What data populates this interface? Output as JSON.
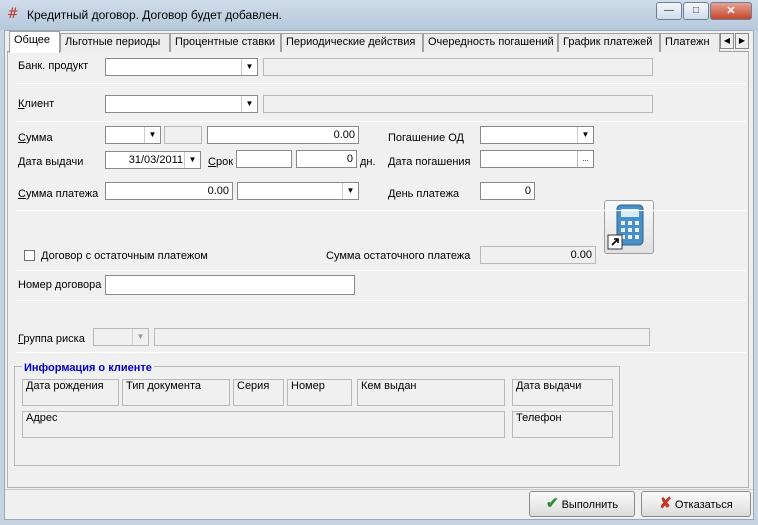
{
  "window": {
    "title": "Кредитный договор. Договор будет добавлен.",
    "title_icon": "hash-icon",
    "controls": {
      "minimize": "—",
      "maximize": "□",
      "close": "✕"
    }
  },
  "tabs": [
    {
      "label": "Общее",
      "active": true
    },
    {
      "label": "Льготные периоды"
    },
    {
      "label": "Процентные ставки"
    },
    {
      "label": "Периодические действия"
    },
    {
      "label": "Очередность погашений"
    },
    {
      "label": "График платежей"
    },
    {
      "label": "Платежн"
    }
  ],
  "tab_scroll": {
    "left": "◀",
    "right": "▶"
  },
  "form": {
    "bank_product_label": "Банк. продукт",
    "bank_product_value": "",
    "client_label": "Клиент",
    "client_value": "",
    "amount_label": "Сумма",
    "amount_currency": "",
    "amount_value": "0.00",
    "repayment_od_label": "Погашение ОД",
    "issue_date_label": "Дата выдачи",
    "issue_date_value": "31/03/2011",
    "term_label": "Срок",
    "term_value": "",
    "term_days_value": "0",
    "term_unit": "дн.",
    "repayment_date_label": "Дата погашения",
    "repayment_date_value": "",
    "repayment_date_btn": "...",
    "payment_amount_label": "Сумма платежа",
    "payment_amount_value": "0.00",
    "payment_day_label": "День платежа",
    "payment_day_value": "0",
    "residual_checkbox_label": "Договор с остаточным платежом",
    "residual_checked": false,
    "residual_amount_label": "Сумма остаточного платежа",
    "residual_amount_value": "0.00",
    "contract_number_label": "Номер договора",
    "contract_number_value": "",
    "risk_group_label": "Группа риска",
    "risk_group_value": ""
  },
  "client_info": {
    "title": "Информация о клиенте",
    "title_color": "#0000cc",
    "birth_date": "Дата рождения",
    "doc_type": "Тип документа",
    "series": "Серия",
    "number": "Номер",
    "issued_by": "Кем выдан",
    "issue_date": "Дата выдачи",
    "address": "Адрес",
    "phone": "Телефон"
  },
  "buttons": {
    "execute": "Выполнить",
    "execute_icon": "checkmark-icon",
    "execute_color": "#2e8b2e",
    "cancel": "Отказаться",
    "cancel_icon": "cross-icon",
    "cancel_color": "#c0392b"
  },
  "icons": {
    "calculator": "calculator-icon",
    "dropdown": "chevron-down-icon"
  }
}
